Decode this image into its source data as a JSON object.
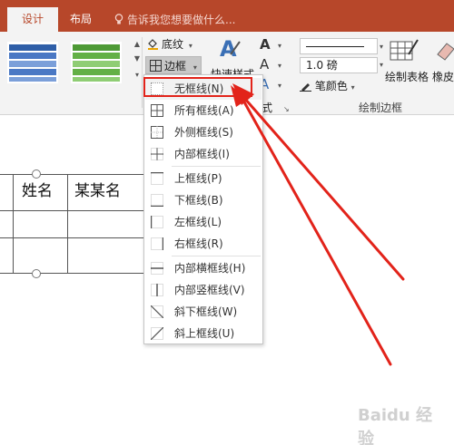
{
  "tabs": [
    {
      "label": "设计",
      "active": true
    },
    {
      "label": "布局",
      "active": false
    }
  ],
  "tell_me": "告诉我您想要做什么...",
  "ribbon": {
    "shading_label": "底纹",
    "borders_label": "边框",
    "quick_styles_label": "快速样式",
    "pen_weight": "1.0 磅",
    "pen_color_label": "笔颜色",
    "draw_table_label": "绘制表格",
    "eraser_label": "橡皮",
    "group_label": "绘制边框"
  },
  "border_menu": {
    "items": [
      {
        "label": "无框线(N)",
        "highlighted": true
      },
      {
        "label": "所有框线(A)"
      },
      {
        "label": "外侧框线(S)"
      },
      {
        "label": "内部框线(I)"
      },
      {
        "label": "上框线(P)"
      },
      {
        "label": "下框线(B)"
      },
      {
        "label": "左框线(L)"
      },
      {
        "label": "右框线(R)"
      },
      {
        "label": "内部横框线(H)"
      },
      {
        "label": "内部竖框线(V)"
      },
      {
        "label": "斜下框线(W)"
      },
      {
        "label": "斜上框线(U)"
      }
    ]
  },
  "table": {
    "cells": [
      "姓名",
      "某某名"
    ]
  },
  "colors": {
    "accent": "#b7472a",
    "annotation_red": "#e2231a",
    "style_blue": "#4a78c4",
    "style_green": "#63b046"
  },
  "watermark": "Baidu 经验"
}
